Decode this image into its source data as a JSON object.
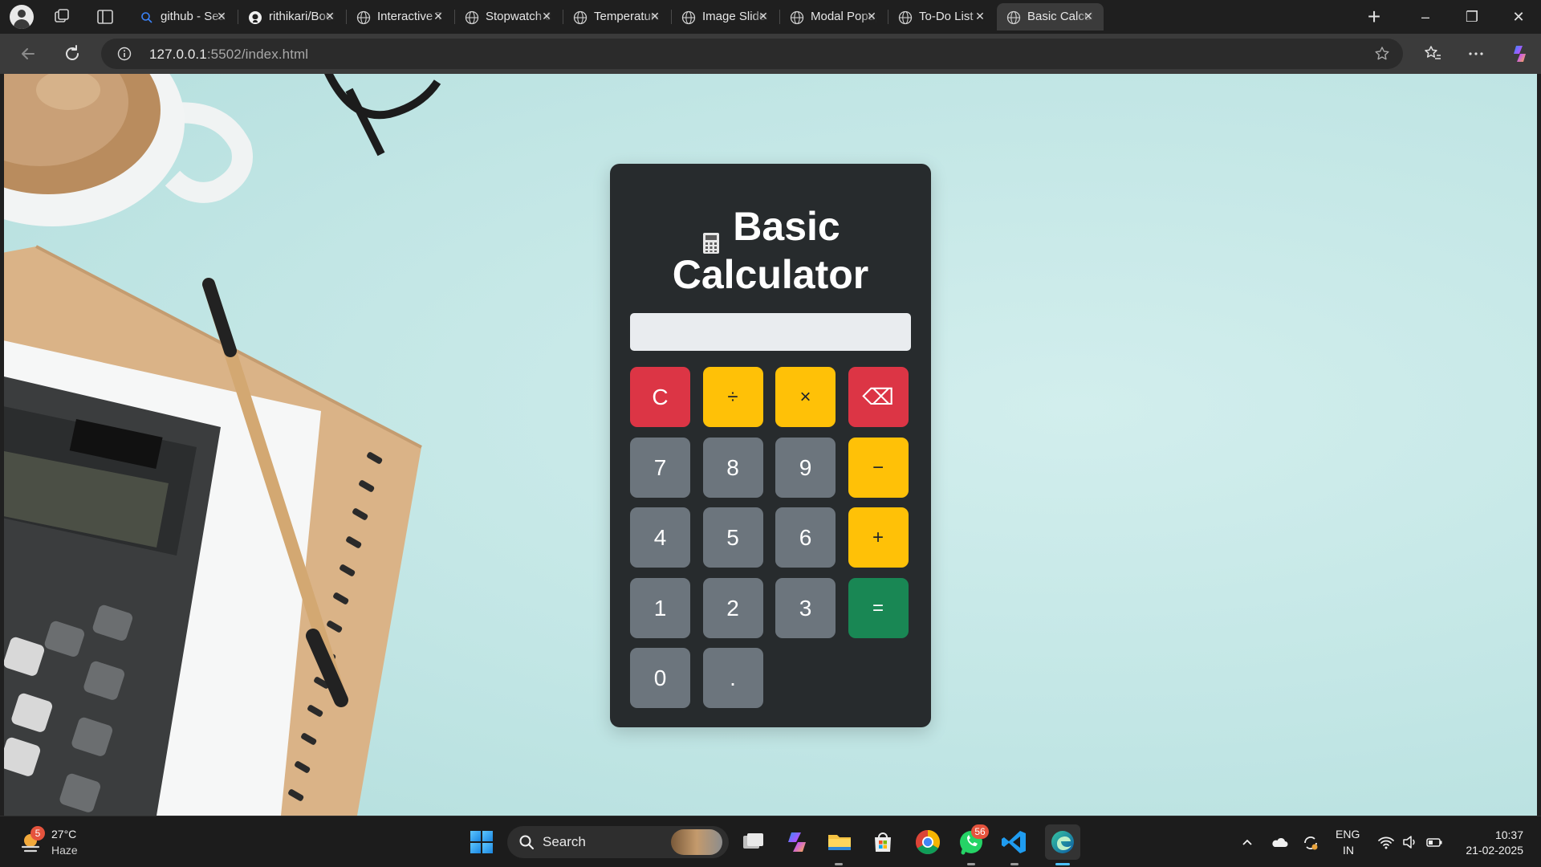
{
  "browser": {
    "tabs": [
      {
        "title": "github - Search",
        "favicon": "search-icon",
        "active": false
      },
      {
        "title": "rithikari/Bootstrap",
        "favicon": "github-icon",
        "active": false
      },
      {
        "title": "Interactive To-Do",
        "favicon": "globe-icon",
        "active": false
      },
      {
        "title": "Stopwatch & Timer",
        "favicon": "globe-icon",
        "active": false
      },
      {
        "title": "Temperature",
        "favicon": "globe-icon",
        "active": false
      },
      {
        "title": "Image Slider",
        "favicon": "globe-icon",
        "active": false
      },
      {
        "title": "Modal Popup",
        "favicon": "globe-icon",
        "active": false
      },
      {
        "title": "To-Do List",
        "favicon": "globe-icon",
        "active": false
      },
      {
        "title": "Basic Calculator",
        "favicon": "globe-icon",
        "active": true
      }
    ],
    "close_glyph": "✕",
    "new_tab_glyph": "+",
    "window_controls": {
      "minimize": "–",
      "restore": "❐",
      "close": "✕"
    },
    "address": {
      "host": "127.0.0.1",
      "rest": ":5502/index.html"
    }
  },
  "app": {
    "title_emoji": "calculator-icon",
    "title": "Basic Calculator",
    "display_value": "",
    "keys": [
      {
        "label": "C",
        "color": "#dc3545"
      },
      {
        "label": "÷",
        "color": "#ffc107"
      },
      {
        "label": "×",
        "color": "#ffc107"
      },
      {
        "label": "⌫",
        "color": "#dc3545"
      },
      {
        "label": "7",
        "color": "#6c757d"
      },
      {
        "label": "8",
        "color": "#6c757d"
      },
      {
        "label": "9",
        "color": "#6c757d"
      },
      {
        "label": "−",
        "color": "#ffc107"
      },
      {
        "label": "4",
        "color": "#6c757d"
      },
      {
        "label": "5",
        "color": "#6c757d"
      },
      {
        "label": "6",
        "color": "#6c757d"
      },
      {
        "label": "+",
        "color": "#ffc107"
      },
      {
        "label": "1",
        "color": "#6c757d"
      },
      {
        "label": "2",
        "color": "#6c757d"
      },
      {
        "label": "3",
        "color": "#6c757d"
      },
      {
        "label": "=",
        "color": "#198754"
      },
      {
        "label": "0",
        "color": "#6c757d"
      },
      {
        "label": ".",
        "color": "#6c757d"
      }
    ],
    "panel_color": "#272b2d",
    "background_color": "#c2e6e5"
  },
  "taskbar": {
    "weather": {
      "temp": "27°C",
      "condition": "Haze",
      "badge": "5"
    },
    "search_label": "Search",
    "apps": [
      "windows-start-icon",
      "task-view-icon",
      "copilot-icon",
      "file-explorer-icon",
      "microsoft-store-icon",
      "chrome-icon",
      "whatsapp-icon",
      "vscode-icon",
      "edge-icon"
    ],
    "whatsapp_badge": "56",
    "tray": {
      "language": "ENG",
      "region": "IN"
    },
    "clock": {
      "time": "10:37",
      "date": "21-02-2025"
    }
  }
}
